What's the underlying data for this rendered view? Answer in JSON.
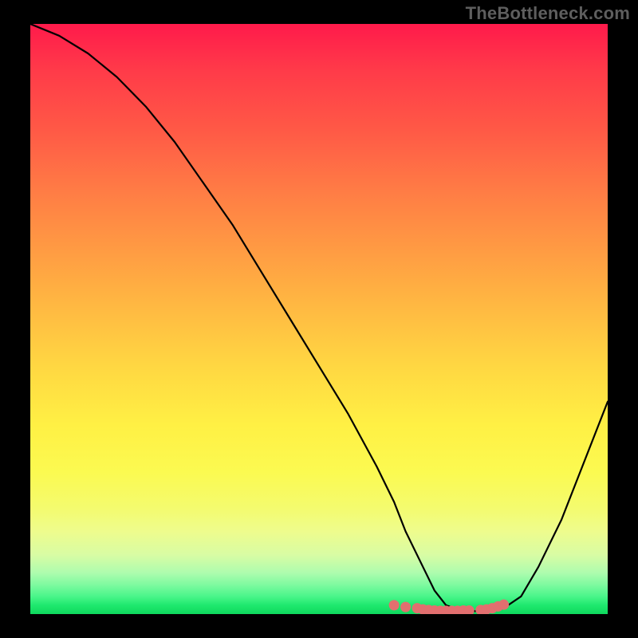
{
  "watermark": "TheBottleneck.com",
  "colors": {
    "background": "#000000",
    "marker": "#e26f6f",
    "curve": "#000000"
  },
  "chart_data": {
    "type": "line",
    "title": "",
    "xlabel": "",
    "ylabel": "",
    "xlim": [
      0,
      100
    ],
    "ylim": [
      0,
      100
    ],
    "x": [
      0,
      5,
      10,
      15,
      20,
      25,
      30,
      35,
      40,
      45,
      50,
      55,
      60,
      63,
      65,
      68,
      70,
      72,
      74,
      76,
      78,
      80,
      82,
      85,
      88,
      92,
      96,
      100
    ],
    "values": [
      100,
      98,
      95,
      91,
      86,
      80,
      73,
      66,
      58,
      50,
      42,
      34,
      25,
      19,
      14,
      8,
      4,
      1.5,
      0.8,
      0.5,
      0.5,
      0.6,
      1.0,
      3,
      8,
      16,
      26,
      36
    ],
    "marker_points": {
      "x": [
        63,
        65,
        67,
        68,
        69,
        70,
        71,
        72,
        73,
        74,
        75,
        76,
        78,
        79,
        80,
        81,
        82
      ],
      "y": [
        1.5,
        1.2,
        1.0,
        0.8,
        0.7,
        0.6,
        0.55,
        0.55,
        0.55,
        0.55,
        0.6,
        0.6,
        0.7,
        0.8,
        1.0,
        1.3,
        1.6
      ]
    },
    "annotations": [
      "TheBottleneck.com"
    ]
  }
}
